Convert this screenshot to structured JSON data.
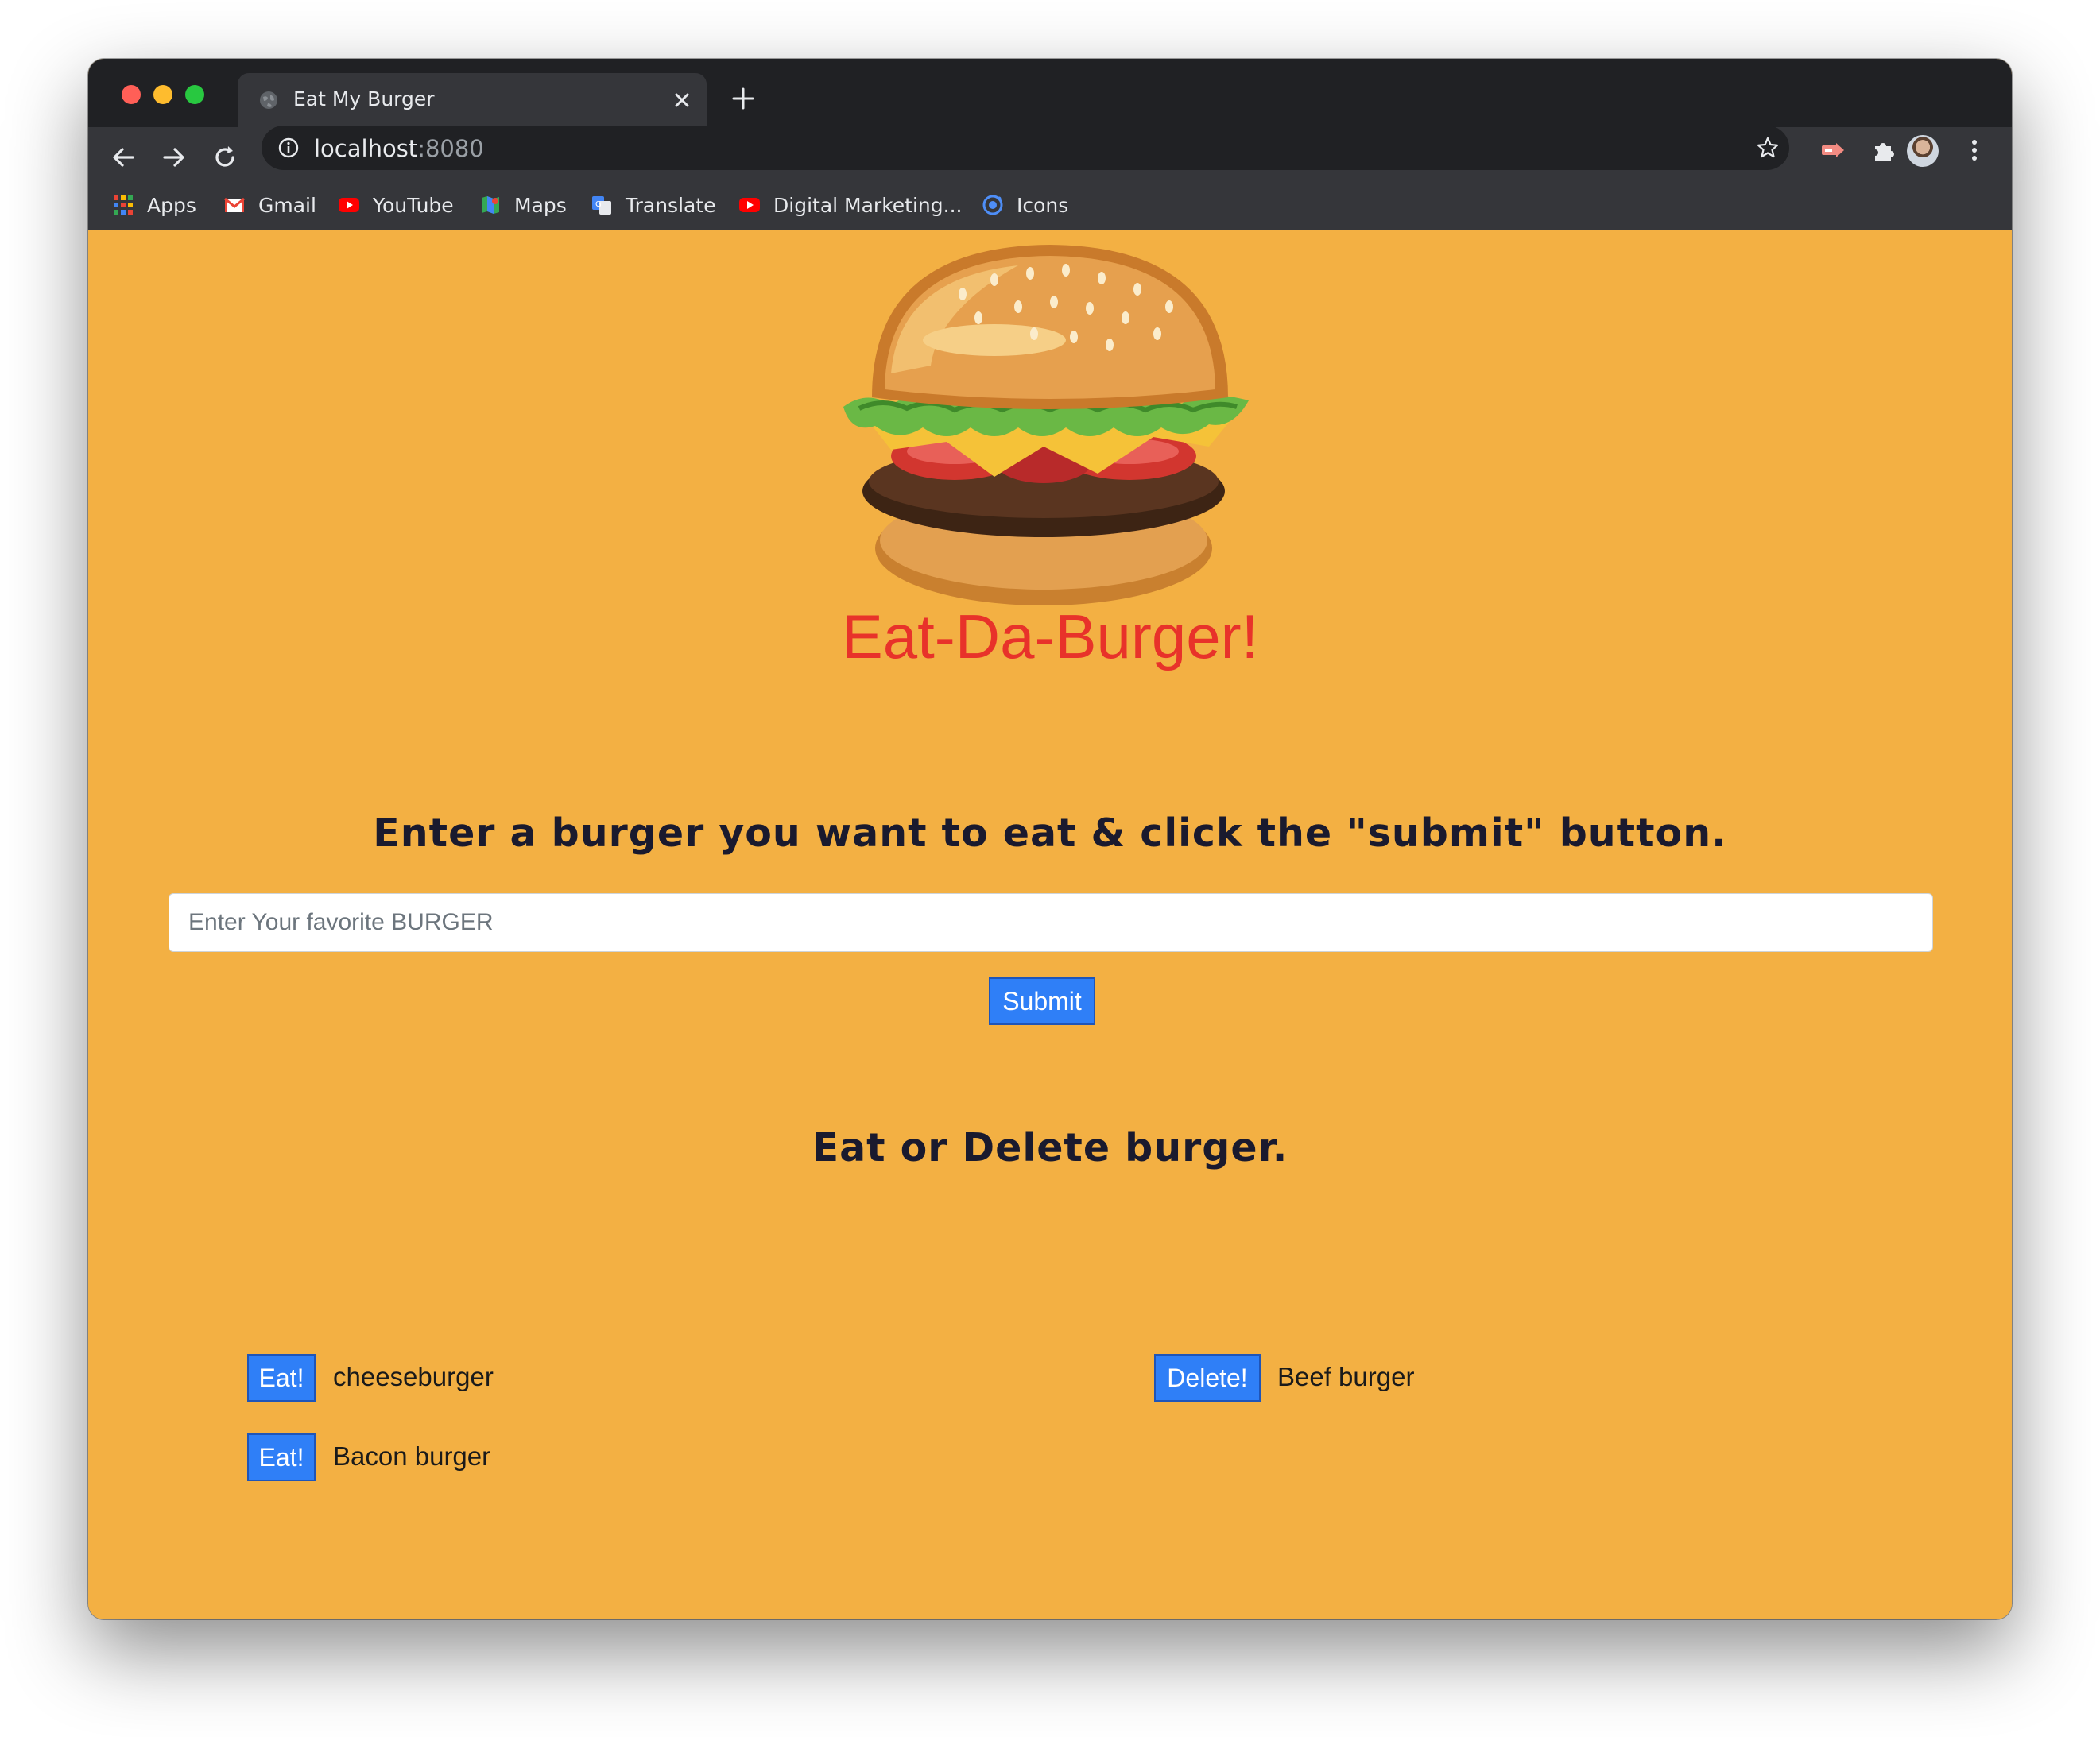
{
  "browser": {
    "tab_title": "Eat My Burger",
    "url_host": "localhost",
    "url_port": ":8080",
    "bookmarks": [
      {
        "label": "Apps",
        "icon": "apps-grid-icon"
      },
      {
        "label": "Gmail",
        "icon": "gmail-icon"
      },
      {
        "label": "YouTube",
        "icon": "youtube-icon"
      },
      {
        "label": "Maps",
        "icon": "maps-icon"
      },
      {
        "label": "Translate",
        "icon": "translate-icon"
      },
      {
        "label": "Digital Marketing...",
        "icon": "youtube-icon"
      },
      {
        "label": "Icons",
        "icon": "ionic-icon"
      }
    ]
  },
  "page": {
    "title": "Eat-Da-Burger!",
    "instruction": "Enter a burger you want to eat & click the \"submit\" button.",
    "input_placeholder": "Enter Your favorite BURGER",
    "submit_label": "Submit",
    "list_heading": "Eat or Delete burger.",
    "uneaten": [
      {
        "action": "Eat!",
        "name": "cheeseburger"
      },
      {
        "action": "Eat!",
        "name": "Bacon burger"
      }
    ],
    "eaten": [
      {
        "action": "Delete!",
        "name": "Beef burger"
      }
    ]
  },
  "colors": {
    "page_background": "#f3b043",
    "title": "#e8322a",
    "button": "#2f7ff7"
  }
}
